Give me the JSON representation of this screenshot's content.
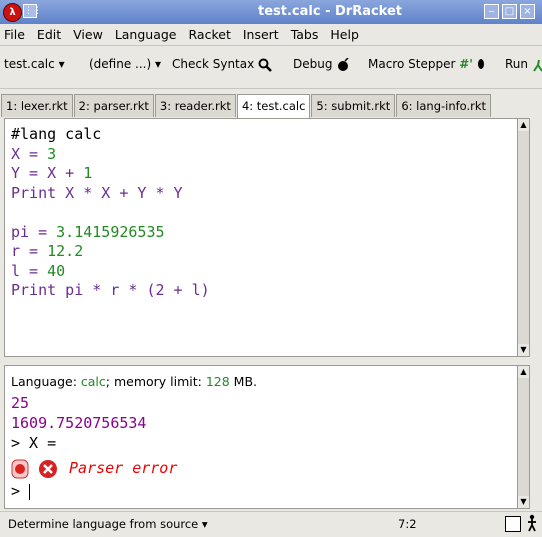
{
  "window": {
    "title": "test.calc - DrRacket"
  },
  "menu": {
    "items": [
      "File",
      "Edit",
      "View",
      "Language",
      "Racket",
      "Insert",
      "Tabs",
      "Help"
    ]
  },
  "toolbar": {
    "file_label": "test.calc",
    "define_label": "(define ...)",
    "check_syntax": "Check Syntax",
    "debug": "Debug",
    "macro_stepper": "Macro Stepper",
    "macro_glyph": "#'",
    "run": "Run"
  },
  "tabs": [
    "1: lexer.rkt",
    "2: parser.rkt",
    "3: reader.rkt",
    "4: test.calc",
    "5: submit.rkt",
    "6: lang-info.rkt"
  ],
  "active_tab": 3,
  "editor": {
    "lines": [
      {
        "segments": [
          {
            "t": "#lang calc",
            "c": "#000000"
          }
        ]
      },
      {
        "segments": [
          {
            "t": "X",
            "c": "#6b2d91"
          },
          {
            "t": " = ",
            "c": "#6b2d91"
          },
          {
            "t": "3",
            "c": "#228b22"
          }
        ]
      },
      {
        "segments": [
          {
            "t": "Y = X + ",
            "c": "#6b2d91"
          },
          {
            "t": "1",
            "c": "#228b22"
          }
        ]
      },
      {
        "segments": [
          {
            "t": "Print X * X + Y * Y",
            "c": "#6b2d91"
          }
        ]
      },
      {
        "segments": [
          {
            "t": "",
            "c": "#000000"
          }
        ]
      },
      {
        "segments": [
          {
            "t": "pi = ",
            "c": "#6b2d91"
          },
          {
            "t": "3.1415926535",
            "c": "#228b22"
          }
        ]
      },
      {
        "segments": [
          {
            "t": "r = ",
            "c": "#6b2d91"
          },
          {
            "t": "12.2",
            "c": "#228b22"
          }
        ]
      },
      {
        "segments": [
          {
            "t": "l = ",
            "c": "#6b2d91"
          },
          {
            "t": "40",
            "c": "#228b22"
          }
        ]
      },
      {
        "segments": [
          {
            "t": "Print pi * r * (2 + l)",
            "c": "#6b2d91"
          }
        ]
      }
    ]
  },
  "interactions": {
    "language_prefix": "Language: ",
    "language_name": "calc",
    "language_suffix": "; memory limit: ",
    "memory_limit": "128",
    "memory_unit": " MB.",
    "outputs": [
      "25",
      "1609.7520756534"
    ],
    "last_input": "> X =",
    "error_message": "Parser error",
    "prompt": "> "
  },
  "status": {
    "language_selector": "Determine language from source",
    "position": "7:2"
  },
  "colors": {
    "keyword": "#6b2d91",
    "number": "#228b22",
    "output": "#8b008b",
    "error": "#e00000"
  }
}
